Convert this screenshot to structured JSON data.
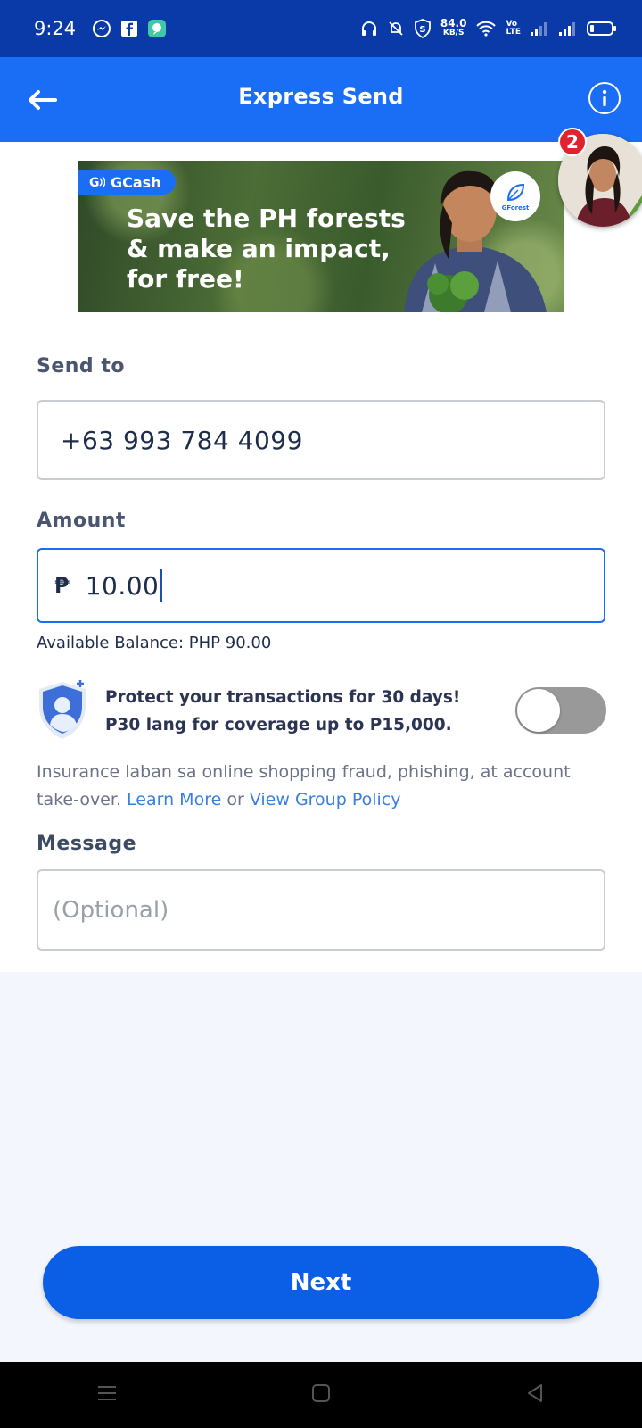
{
  "status_bar": {
    "time": "9:24",
    "speed_value": "84.0",
    "speed_unit": "KB/S",
    "volte_top": "Vo",
    "volte_bottom": "LTE"
  },
  "header": {
    "title": "Express Send"
  },
  "banner": {
    "brand": "GCash",
    "line1": "Save the PH forests",
    "line2": "& make an impact,",
    "line3": "for free!",
    "badge_label": "GForest"
  },
  "chat_head": {
    "badge_count": "2"
  },
  "form": {
    "send_to_label": "Send to",
    "send_to_value": "+63 993 784 4099",
    "amount_label": "Amount",
    "currency_symbol": "₱",
    "amount_value": "10.00",
    "available_balance": "Available Balance: PHP 90.00",
    "protect_line1": "Protect your transactions for 30 days!",
    "protect_line2": "P30 lang for coverage up to P15,000.",
    "insurance_text": "Insurance laban sa online shopping fraud, phishing, at account take-over.",
    "learn_more": "Learn More",
    "or_text": "or",
    "group_policy": "View Group Policy",
    "message_label": "Message",
    "message_placeholder": "(Optional)"
  },
  "actions": {
    "next_label": "Next"
  },
  "colors": {
    "primary": "#1a6ef5",
    "status_bar": "#0a3aa8",
    "button": "#0b5ee6",
    "badge": "#e0242f"
  }
}
